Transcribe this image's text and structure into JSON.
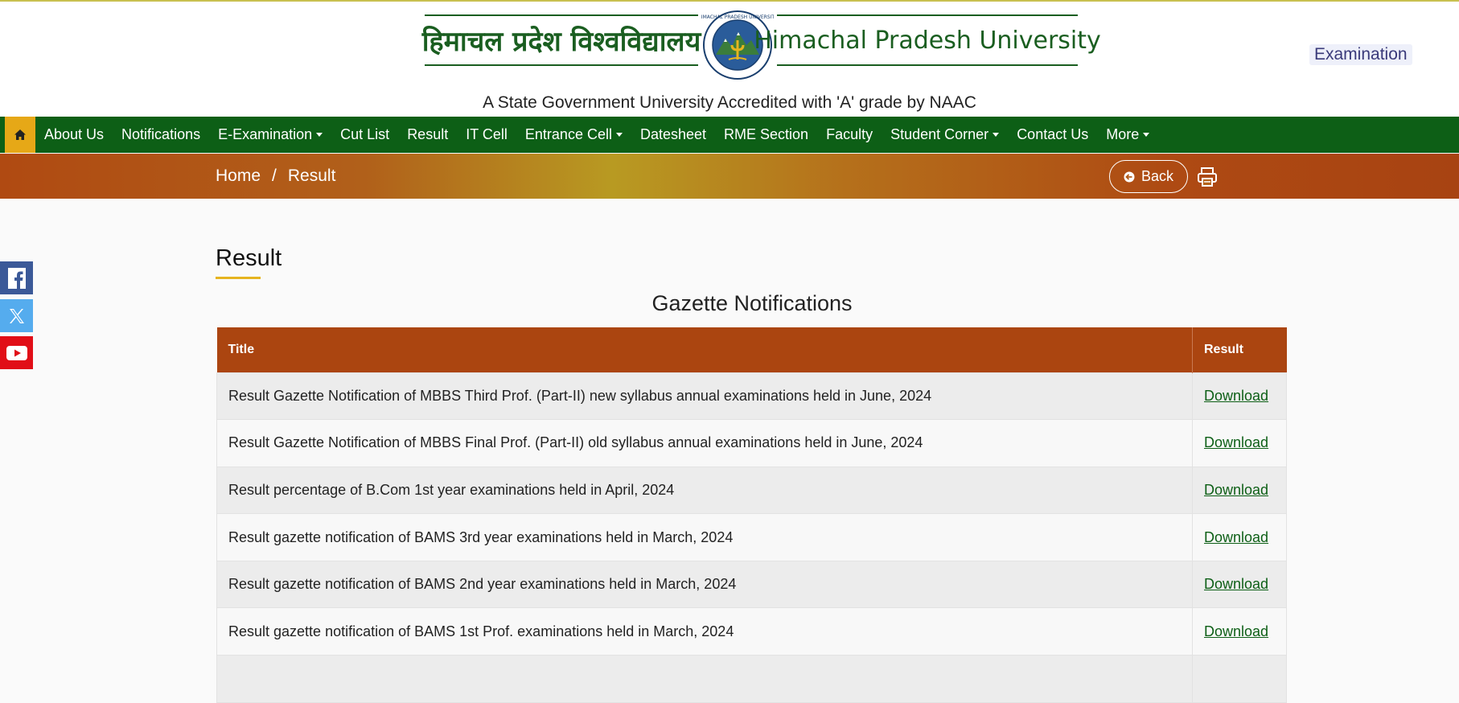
{
  "header": {
    "brand_hindi": "हिमाचल प्रदेश विश्वविद्यालय",
    "brand_english": "Himachal Pradesh University",
    "seal_text": "HIMACHAL PRADESH UNIVERSITY",
    "tagline": "A State Government University Accredited with 'A' grade by NAAC",
    "examination_link": "Examination"
  },
  "nav": {
    "home_icon": "home-icon",
    "items": [
      {
        "label": "About Us",
        "dropdown": false
      },
      {
        "label": "Notifications",
        "dropdown": false
      },
      {
        "label": "E-Examination",
        "dropdown": true
      },
      {
        "label": "Cut List",
        "dropdown": false
      },
      {
        "label": "Result",
        "dropdown": false
      },
      {
        "label": "IT Cell",
        "dropdown": false
      },
      {
        "label": "Entrance Cell",
        "dropdown": true
      },
      {
        "label": "Datesheet",
        "dropdown": false
      },
      {
        "label": "RME Section",
        "dropdown": false
      },
      {
        "label": "Faculty",
        "dropdown": false
      },
      {
        "label": "Student Corner",
        "dropdown": true
      },
      {
        "label": "Contact Us",
        "dropdown": false
      },
      {
        "label": "More",
        "dropdown": true
      }
    ]
  },
  "breadcrumb": {
    "home": "Home",
    "separator": "/",
    "current": "Result",
    "back_label": "Back"
  },
  "social": [
    "facebook-icon",
    "x-twitter-icon",
    "youtube-icon"
  ],
  "main": {
    "page_title": "Result",
    "section_title": "Gazette Notifications",
    "table": {
      "columns": [
        "Title",
        "Result"
      ],
      "rows": [
        {
          "title": "Result Gazette Notification of MBBS Third Prof. (Part-II) new syllabus annual examinations held in June, 2024",
          "link": "Download"
        },
        {
          "title": "Result Gazette Notification of MBBS Final Prof. (Part-II) old syllabus annual examinations held in June, 2024",
          "link": "Download"
        },
        {
          "title": "Result percentage of B.Com 1st year examinations held in April, 2024",
          "link": "Download"
        },
        {
          "title": "Result  gazette notification of BAMS 3rd year examinations held in March, 2024",
          "link": "Download"
        },
        {
          "title": "Result  gazette notification of BAMS 2nd year examinations held in March, 2024",
          "link": "Download"
        },
        {
          "title": "Result  gazette notification of BAMS 1st Prof. examinations held in March, 2024",
          "link": "Download"
        },
        {
          "title": "",
          "link": ""
        }
      ]
    }
  },
  "colors": {
    "nav_green": "#0d5f16",
    "home_orange": "#e6a817",
    "table_header": "#ab4510",
    "title_underline": "#e6b41f"
  }
}
